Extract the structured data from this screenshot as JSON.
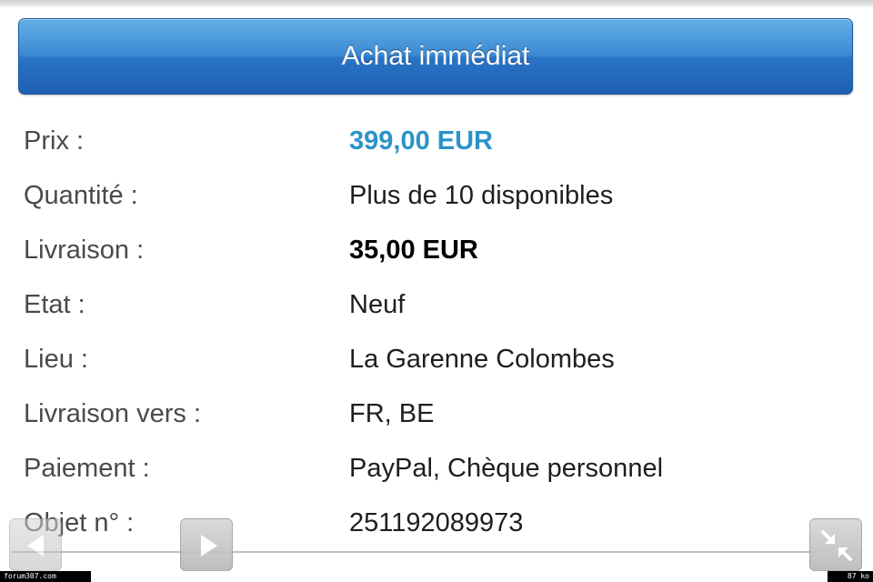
{
  "buy_button": {
    "label": "Achat immédiat",
    "color": "#2a74c5"
  },
  "colors": {
    "price": "#2b93c8"
  },
  "details": {
    "rows": [
      {
        "label": "Prix :",
        "value": "399,00 EUR"
      },
      {
        "label": "Quantité :",
        "value": "Plus de 10 disponibles"
      },
      {
        "label": "Livraison :",
        "value": "35,00 EUR"
      },
      {
        "label": "Etat :",
        "value": "Neuf"
      },
      {
        "label": "Lieu :",
        "value": "La Garenne Colombes"
      },
      {
        "label": "Livraison vers :",
        "value": "FR, BE"
      },
      {
        "label": "Paiement :",
        "value": "PayPal, Chèque personnel"
      },
      {
        "label": "Objet n° :",
        "value": "251192089973"
      }
    ]
  },
  "overlay": {
    "prev_icon": "triangle-left-icon",
    "next_icon": "triangle-right-icon",
    "fullscreen_icon": "collapse-arrows-icon"
  },
  "footer": {
    "left_text": "forum307.com",
    "right_text": "87 ko"
  }
}
